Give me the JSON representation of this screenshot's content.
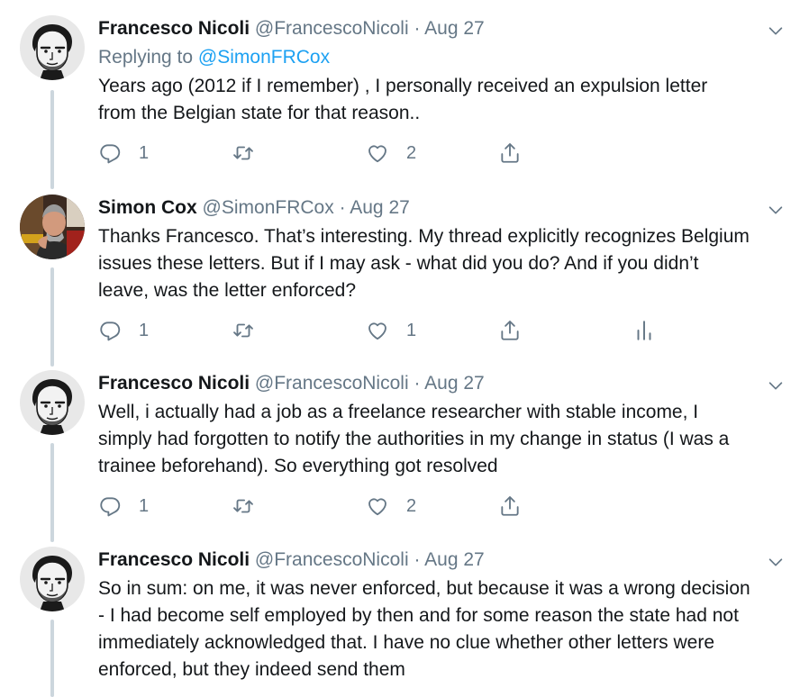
{
  "colors": {
    "text": "#14171a",
    "muted": "#657786",
    "link": "#1da1f2",
    "thread_line": "#ccd6dd"
  },
  "tweets": [
    {
      "name": "Francesco Nicoli",
      "handle": "@FrancescoNicoli",
      "separator": "·",
      "date": "Aug 27",
      "replying_prefix": "Replying to",
      "replying_to": "@SimonFRCox",
      "lines": [
        "Years ago (2012 if I remember) , I personally received an expulsion letter",
        "from the Belgian state for that reason.."
      ],
      "reply_count": "1",
      "like_count": "2"
    },
    {
      "name": "Simon Cox",
      "handle": "@SimonFRCox",
      "separator": "·",
      "date": "Aug 27",
      "lines": [
        "Thanks Francesco. That’s interesting. My thread explicitly recognizes Belgium",
        "issues these letters. But if I may ask - what did you do? And if you didn’t",
        "leave, was the letter enforced?"
      ],
      "reply_count": "1",
      "like_count": "1"
    },
    {
      "name": "Francesco Nicoli",
      "handle": "@FrancescoNicoli",
      "separator": "·",
      "date": "Aug 27",
      "lines": [
        "Well, i actually had a job as a freelance  researcher with stable income, I",
        "simply had forgotten to notify the authorities in my change in status (I was a",
        "trainee beforehand). So everything got resolved"
      ],
      "reply_count": "1",
      "like_count": "2"
    },
    {
      "name": "Francesco Nicoli",
      "handle": "@FrancescoNicoli",
      "separator": "·",
      "date": "Aug 27",
      "lines": [
        "So in sum: on me, it was never enforced, but because it was a wrong decision",
        "- I had become self employed by then and for some reason the state had not",
        "immediately acknowledged that. I have no clue whether other letters were",
        "enforced, but they indeed send them"
      ]
    }
  ]
}
